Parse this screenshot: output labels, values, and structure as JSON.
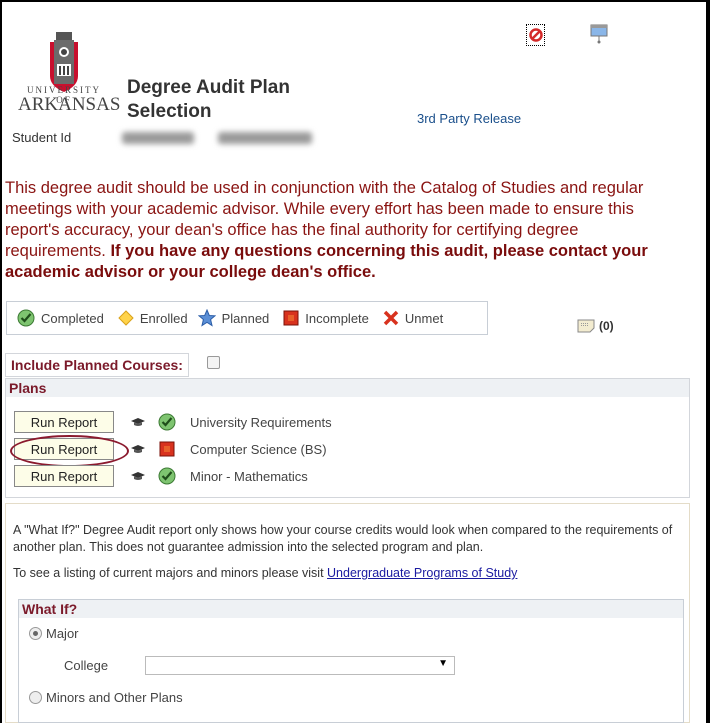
{
  "header": {
    "logo": {
      "line1": "UNIVERSITY OF",
      "line2": "ARKANSAS"
    },
    "title": "Degree Audit Plan Selection",
    "student_id_label": "Student Id",
    "third_party_link": "3rd Party Release",
    "icons": [
      "no-entry-icon",
      "preferences-icon"
    ]
  },
  "notice": {
    "text": "This degree audit should be used in conjunction with the Catalog of Studies and regular meetings with your academic advisor. While every effort has been made to ensure this report's accuracy, your dean's office has the final authority for certifying degree requirements. ",
    "bold": "If you have any questions concerning this audit, please contact your academic advisor or your college dean's office."
  },
  "legend": [
    {
      "icon": "check-icon",
      "label": "Completed"
    },
    {
      "icon": "diamond-icon",
      "label": "Enrolled"
    },
    {
      "icon": "star-icon",
      "label": "Planned"
    },
    {
      "icon": "incomplete-square-icon",
      "label": "Incomplete"
    },
    {
      "icon": "x-icon",
      "label": "Unmet"
    }
  ],
  "notes": {
    "count": "(0)"
  },
  "include_planned": {
    "label": "Include Planned Courses:",
    "checked": false
  },
  "plans": {
    "heading": "Plans",
    "rows": [
      {
        "button": "Run Report",
        "status": "completed",
        "name": "University Requirements"
      },
      {
        "button": "Run Report",
        "status": "incomplete",
        "name": "Computer Science  (BS)"
      },
      {
        "button": "Run Report",
        "status": "completed",
        "name": "Minor - Mathematics"
      }
    ]
  },
  "what_if": {
    "description": "A \"What If?\" Degree Audit report only shows how your course credits would look when compared to the requirements of another plan. This does not guarantee admission into the selected program and plan.",
    "listing_prefix": "To see a listing of current majors and minors please visit ",
    "listing_link": "Undergraduate Programs of Study",
    "heading": "What If?",
    "major_label": "Major",
    "college_label": "College",
    "college_value": "",
    "minors_label": "Minors and Other Plans",
    "selected": "Major"
  }
}
